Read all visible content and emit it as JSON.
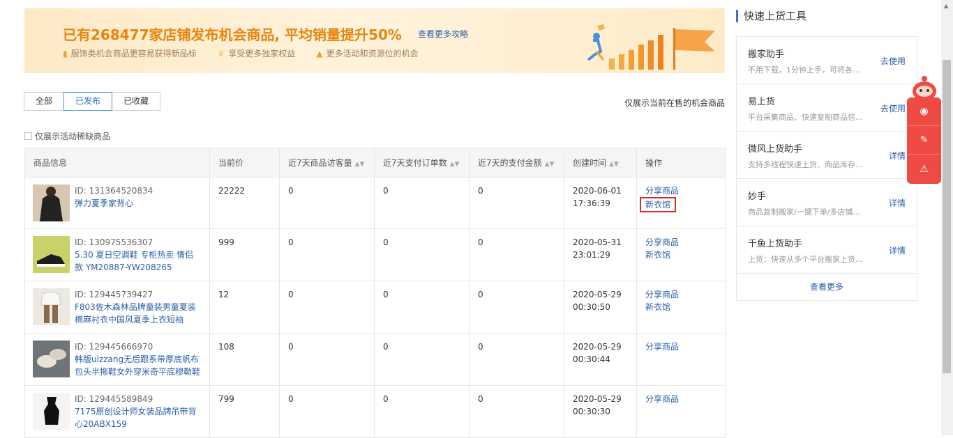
{
  "banner": {
    "title": "已有268477家店铺发布机会商品, 平均销量提升50%",
    "link": "查看更多攻略",
    "features": [
      {
        "icon": "bookmark-icon",
        "text": "服饰类机会商品更容易获得新品标"
      },
      {
        "icon": "crown-icon",
        "text": "享受更多独家权益"
      },
      {
        "icon": "fire-icon",
        "text": "更多活动和资源位的机会"
      }
    ]
  },
  "filters": {
    "tabs": [
      "全部",
      "已发布",
      "已收藏"
    ],
    "active": "已发布"
  },
  "note": "仅展示当前在售的机会商品",
  "checkbox_label": "仅展示活动稀缺商品",
  "table": {
    "headers": [
      "商品信息",
      "当前价",
      "近7天商品访客量",
      "近7天支付订单数",
      "近7天的支付金额",
      "创建时间",
      "操作"
    ],
    "rows": [
      {
        "id": "ID: 131364520834",
        "name": "弹力夏季家背心",
        "price": "22222",
        "visitors": "0",
        "orders": "0",
        "amount": "0",
        "date": "2020-06-01",
        "time": "17:36:39",
        "op1": "分享商品",
        "op2": "新衣馆"
      },
      {
        "id": "ID: 130975536307",
        "name": "5.30 夏日空调鞋 专柜热卖 情侣款 YM20887-YW208265",
        "price": "999",
        "visitors": "0",
        "orders": "0",
        "amount": "0",
        "date": "2020-05-31",
        "time": "23:01:29",
        "op1": "分享商品",
        "op2": "新衣馆"
      },
      {
        "id": "ID: 129445739427",
        "name": "F803佐木森林品牌童装男童夏装棉麻衬衣中国风夏季上衣短袖",
        "price": "12",
        "visitors": "0",
        "orders": "0",
        "amount": "0",
        "date": "2020-05-29",
        "time": "00:30:50",
        "op1": "分享商品",
        "op2": "新衣馆"
      },
      {
        "id": "ID: 129445666970",
        "name": "韩版ulzzang无后跟系带厚底帆布包头半拖鞋女外穿米奇平底穆勒鞋",
        "price": "108",
        "visitors": "0",
        "orders": "0",
        "amount": "0",
        "date": "2020-05-29",
        "time": "00:30:44",
        "op1": "分享商品",
        "op2": ""
      },
      {
        "id": "ID: 129445589849",
        "name": "7175原创设计师女装品牌吊带背心20ABX159",
        "price": "799",
        "visitors": "0",
        "orders": "0",
        "amount": "0",
        "date": "2020-05-29",
        "time": "00:30:30",
        "op1": "分享商品",
        "op2": ""
      }
    ]
  },
  "sidebar": {
    "title": "快速上货工具",
    "tools": [
      {
        "name": "搬家助手",
        "desc": "不用下载，1分钟上手，可将各...",
        "action": "去使用"
      },
      {
        "name": "易上货",
        "desc": "平台采集商品、快速复制商品信...",
        "action": "去使用"
      },
      {
        "name": "微风上货助手",
        "desc": "支持多线程快速上货、商品库存...",
        "action": "详情"
      },
      {
        "name": "妙手",
        "desc": "商品复制搬家/一键下单/多店铺...",
        "action": "详情"
      },
      {
        "name": "千鱼上货助手",
        "desc": "上货：快速从多个平台搬家上货...",
        "action": "详情"
      }
    ],
    "more": "查看更多"
  },
  "float_bar": {
    "icons": [
      "chat-icon",
      "edit-icon",
      "warning-icon"
    ]
  },
  "colors": {
    "accent": "#2a7ad2",
    "link": "#2a5ea8",
    "banner_title": "#e8850d",
    "highlight": "#d93025",
    "float": "#ef4a43"
  }
}
